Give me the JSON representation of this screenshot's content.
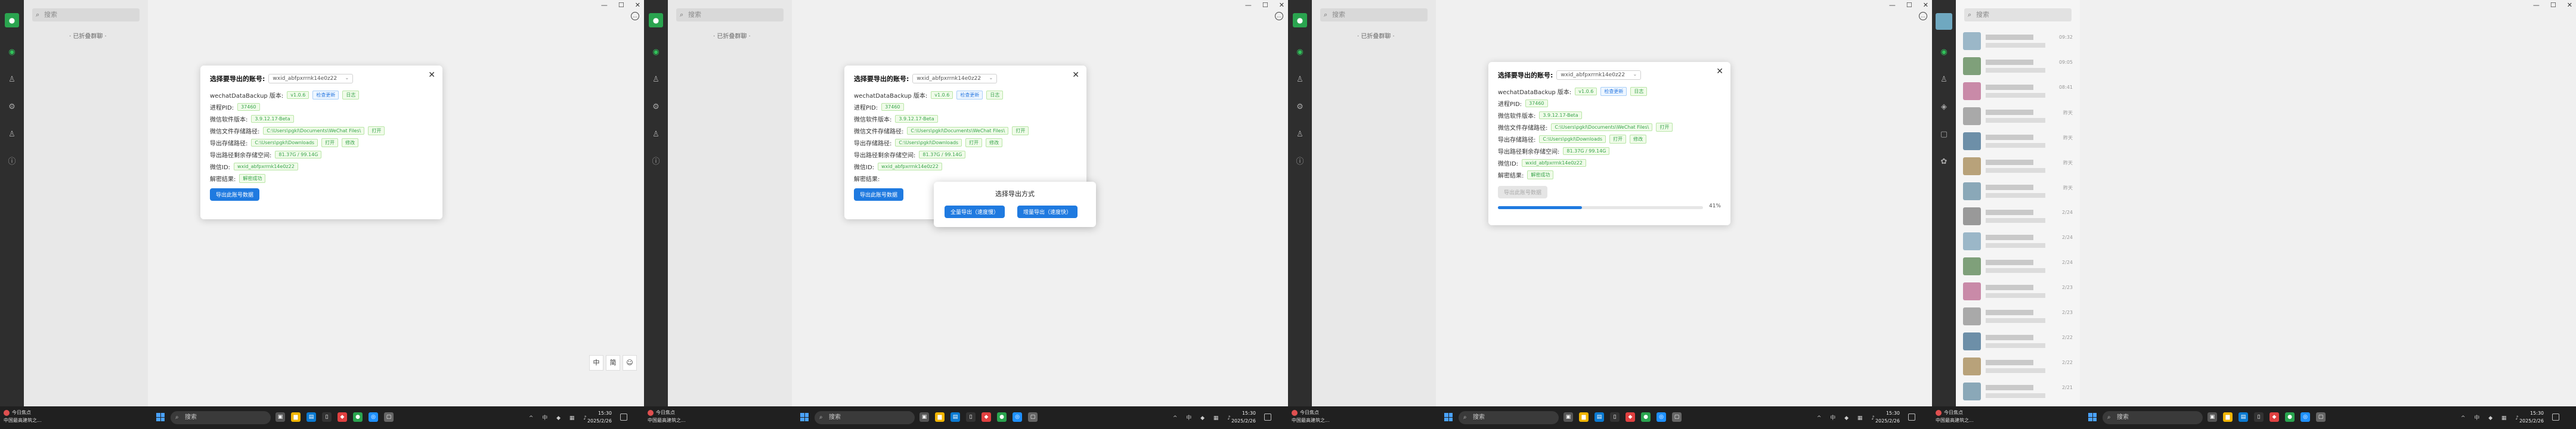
{
  "common": {
    "search_placeholder": "搜索",
    "pinned_label": "· 已折叠群聊 ·",
    "window_controls": [
      "—",
      "☐",
      "✕"
    ],
    "taskbar": {
      "weather_line1": "今日焦点",
      "weather_line2": "中国最高建筑之...",
      "search_label": "搜索",
      "time": "15:30",
      "date": "2025/2/26",
      "tray": "^ 中 ◆ ▦ ♪"
    }
  },
  "dialog": {
    "title": "选择要导出的账号:",
    "account": "wxid_abfpxrrnk14e0z22",
    "rows": [
      {
        "label": "wechatDataBackup 版本:",
        "tags": [
          "v1.0.6"
        ],
        "tags_blue": [
          "检查更新"
        ],
        "tags_extra": [
          "日志"
        ]
      },
      {
        "label": "进程PID:",
        "tags": [
          "37460"
        ]
      },
      {
        "label": "微信软件版本:",
        "tags": [
          "3.9.12.17-Beta"
        ]
      },
      {
        "label": "微信文件存储路径:",
        "tags": [
          "C:\\Users\\pgkl\\Documents\\WeChat Files\\"
        ],
        "tags_extra": [
          "打开"
        ]
      },
      {
        "label": "导出存储路径:",
        "tags": [
          "C:\\Users\\pgkl\\Downloads"
        ],
        "tags_extra": [
          "打开",
          "修改"
        ]
      },
      {
        "label": "导出路径剩余存储空间:",
        "tags": [
          "81.37G / 99.14G"
        ]
      },
      {
        "label": "微信ID:",
        "tags": [
          "wxid_abfpxrrnk14e0z22"
        ]
      },
      {
        "label": "解密结果:",
        "tags": [
          "解密成功"
        ]
      }
    ],
    "action_button": "导出此账号数据",
    "disabled_button": "导出此账号数据",
    "progress_percent": 41,
    "progress_label": "41%"
  },
  "popup": {
    "title": "选择导出方式",
    "btn_full": "全量导出（速度慢）",
    "btn_incremental": "增量导出（速度快）"
  },
  "ime": [
    "中",
    "简",
    "☺"
  ],
  "panel4": {
    "search_placeholder": "搜索",
    "times": [
      "09:32",
      "09:05",
      "08:41",
      "昨天",
      "昨天",
      "昨天",
      "昨天",
      "2/24",
      "2/24",
      "2/24",
      "2/23",
      "2/23",
      "2/22",
      "2/22",
      "2/21"
    ],
    "colors": {
      "accent": "#1f7ae0",
      "success": "#3aa64d",
      "wechat_green": "#31c25a"
    }
  }
}
